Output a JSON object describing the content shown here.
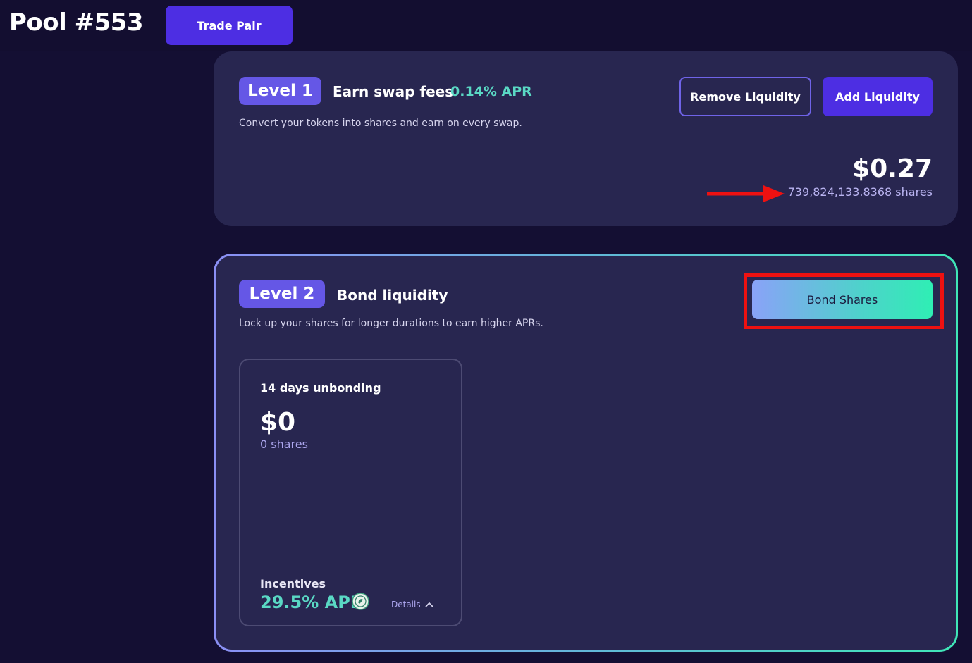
{
  "header": {
    "title": "Pool #553",
    "trade_button": "Trade Pair"
  },
  "level1": {
    "pill": "Level 1",
    "title": "Earn swap fees",
    "apr": "0.14% APR",
    "description": "Convert your tokens into shares and earn on every swap.",
    "remove_button": "Remove Liquidity",
    "add_button": "Add Liquidity",
    "value": "$0.27",
    "shares": "739,824,133.8368 shares"
  },
  "level2": {
    "pill": "Level 2",
    "title": "Bond liquidity",
    "description": "Lock up your shares for longer durations to earn higher APRs.",
    "bond_button": "Bond Shares",
    "bond_card": {
      "period": "14 days unbonding",
      "value": "$0",
      "shares": "0 shares",
      "incentives_label": "Incentives",
      "incentives_apr": "29.5% APR",
      "details": "Details"
    }
  },
  "colors": {
    "background": "#140f33",
    "card": "#282650",
    "accent": "#4d2ee3",
    "pill": "#6557e6",
    "apr_green": "#5ad8c4",
    "highlight_red": "#ee1111"
  },
  "icons": [
    "red-arrow-annotation",
    "token-icon",
    "chevron-up-icon"
  ]
}
